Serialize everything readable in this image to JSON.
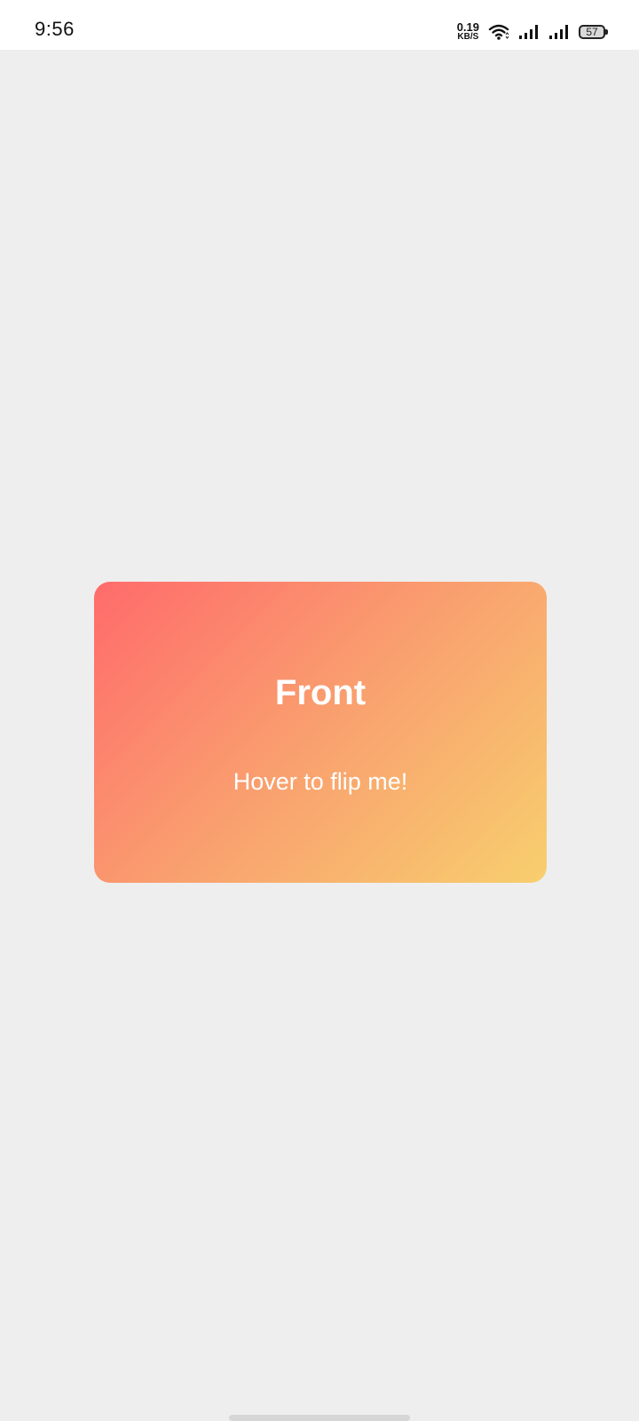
{
  "status_bar": {
    "time": "9:56",
    "net_speed_value": "0.19",
    "net_speed_unit": "KB/S",
    "battery_level": "57",
    "icons": [
      "wifi-icon",
      "signal-icon",
      "signal-icon",
      "battery-icon"
    ]
  },
  "card": {
    "title": "Front",
    "subtitle": "Hover to flip me!",
    "gradient_colors": [
      "#ff6b6b",
      "#f9a06f",
      "#f8cf6e"
    ]
  },
  "colors": {
    "background": "#eeeeee",
    "status_bar": "#ffffff"
  }
}
